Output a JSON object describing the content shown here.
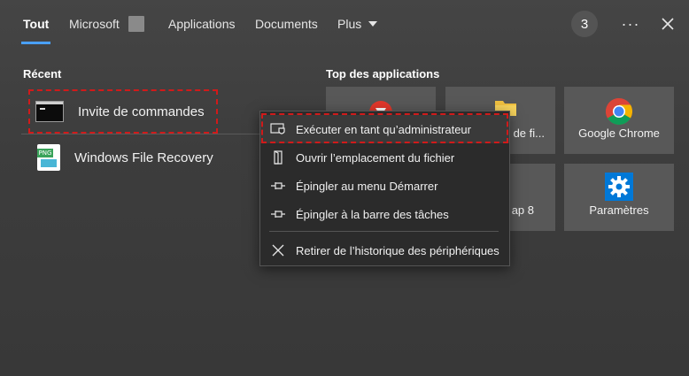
{
  "tabs": [
    {
      "label": "Tout",
      "active": true
    },
    {
      "label": "Microsoft",
      "active": false
    },
    {
      "label": "Applications",
      "active": false
    },
    {
      "label": "Documents",
      "active": false
    },
    {
      "label": "Plus",
      "active": false
    }
  ],
  "header": {
    "badge_count": "3",
    "more_label": "···"
  },
  "recent": {
    "title": "Récent",
    "items": [
      {
        "label": "Invite de commandes",
        "icon": "command-prompt-icon"
      },
      {
        "label": "Windows File Recovery",
        "icon": "png-file-icon"
      }
    ]
  },
  "top_apps": {
    "title": "Top des applications",
    "tiles": [
      {
        "label": "",
        "icon": "red-app-icon"
      },
      {
        "label": "r de fi...",
        "icon": "folder-icon"
      },
      {
        "label": "Google Chrome",
        "icon": "chrome-icon"
      },
      {
        "label": "",
        "icon": ""
      },
      {
        "label": "ap 8",
        "icon": ""
      },
      {
        "label": "Paramètres",
        "icon": "gear-icon"
      }
    ]
  },
  "context_menu": {
    "items": [
      {
        "label": "Exécuter en tant qu’administrateur",
        "icon": "shield-run-icon"
      },
      {
        "label": "Ouvrir l’emplacement du fichier",
        "icon": "open-folder-icon"
      },
      {
        "label": "Épingler au menu Démarrer",
        "icon": "pin-icon"
      },
      {
        "label": "Épingler à la barre des tâches",
        "icon": "pin-icon"
      },
      {
        "label": "Retirer de l’historique des périphériques",
        "icon": "close-icon"
      }
    ]
  },
  "colors": {
    "accent": "#4aa0ff",
    "highlight_dash": "#d11a1a",
    "menu_bg": "#2b2b2b",
    "tile_bg": "#585858"
  }
}
